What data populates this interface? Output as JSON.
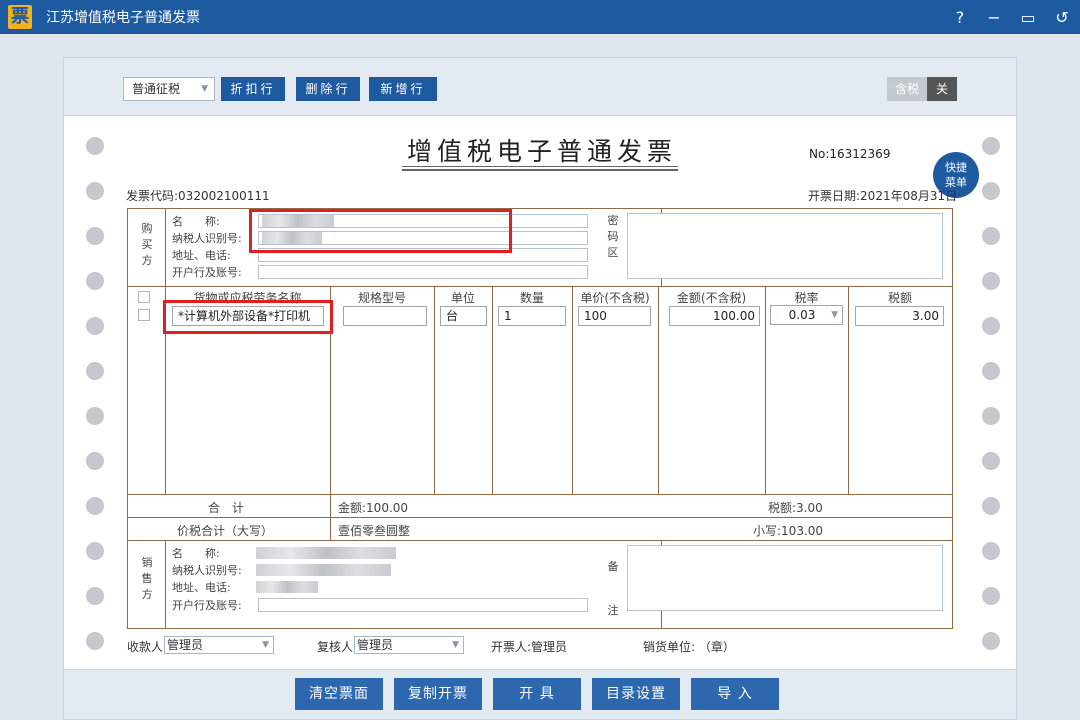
{
  "window": {
    "icon_glyph": "票",
    "title": "江苏增值税电子普通发票",
    "controls": {
      "help": "?",
      "minimize": "−",
      "restore": "▭",
      "back": "↺"
    }
  },
  "toolbar": {
    "tax_type": "普通征税",
    "discount_btn": "折扣行",
    "delete_btn": "删除行",
    "add_btn": "新增行",
    "tax_incl_label": "含税",
    "tax_incl_state": "关"
  },
  "invoice": {
    "title": "增值税电子普通发票",
    "no_label": "No:",
    "no_value": "16312369",
    "quick_menu": "快捷菜单",
    "code_label": "发票代码:",
    "code_value": "032002100111",
    "date_label": "开票日期:",
    "date_value": "2021年08月31日"
  },
  "buyer": {
    "side_label": "购买方",
    "name_label": "名　　称:",
    "taxid_label": "纳税人识别号:",
    "address_label": "地址、电话:",
    "bank_label": "开户行及账号:",
    "cipher_label": "密码区"
  },
  "items": {
    "headers": [
      "货物或应税劳务名称",
      "规格型号",
      "单位",
      "数量",
      "单价(不含税)",
      "金额(不含税)",
      "税率",
      "税额"
    ],
    "row": {
      "name": "*计算机外部设备*打印机",
      "spec": "",
      "unit": "台",
      "qty": "1",
      "price": "100",
      "amount": "100.00",
      "rate": "0.03",
      "tax": "3.00"
    }
  },
  "totals": {
    "total_label": "合　计",
    "amount_text": "金额:100.00",
    "tax_text": "税额:3.00",
    "grand_label": "价税合计（大写）",
    "grand_upper": "壹佰零叁圆整",
    "grand_lower": "小写:103.00"
  },
  "seller": {
    "side_label": "销售方",
    "name_label": "名　　称:",
    "taxid_label": "纳税人识别号:",
    "address_label": "地址、电话:",
    "bank_label": "开户行及账号:",
    "remark_label": "备注"
  },
  "signers": {
    "payee_label": "收款人:",
    "payee_value": "管理员",
    "reviewer_label": "复核人:",
    "reviewer_value": "管理员",
    "drawer_text": "开票人:管理员",
    "seller_text": "销货单位: （章）"
  },
  "footer": {
    "clear_btn": "清空票面",
    "copy_btn": "复制开票",
    "issue_btn": "开 具",
    "catalog_btn": "目录设置",
    "import_btn": "导 入"
  },
  "colors": {
    "primary": "#1d5aa0",
    "highlight": "#e01f1f",
    "grid_line": "#8f6b4a"
  }
}
